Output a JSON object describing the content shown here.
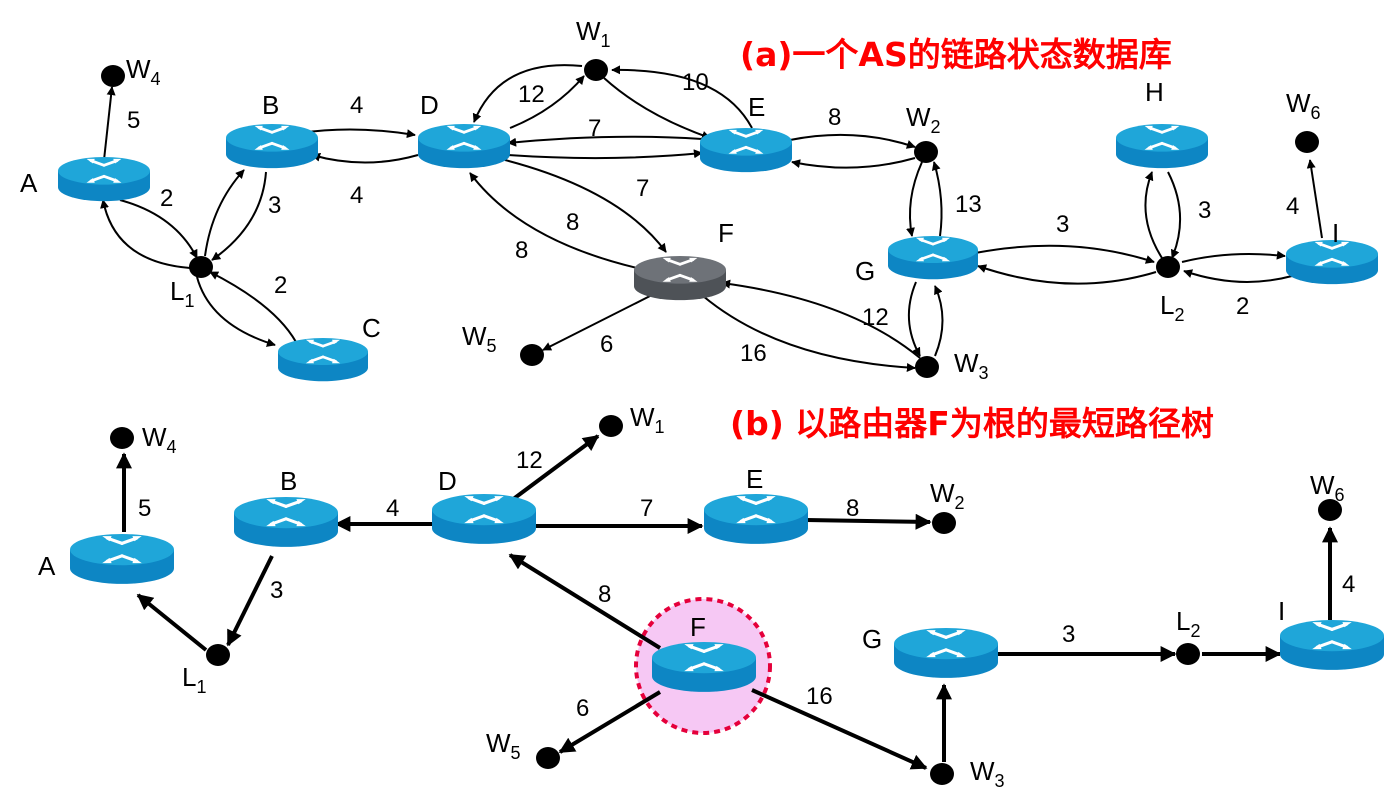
{
  "colors": {
    "title": "#ff0000",
    "router_top": "#1fa6d9",
    "router_body": "#0d86c4",
    "router_special_top": "#6e7278",
    "router_special_body": "#4e5257",
    "node": "#000000",
    "root_ring": "#e5003b",
    "root_fill": "#f6c8f4"
  },
  "icons": {
    "router": "router-icon",
    "network": "network-dot-icon"
  },
  "panel_a": {
    "title": "(a)一个AS的链路状态数据库",
    "routers": {
      "A": "A",
      "B": "B",
      "C": "C",
      "D": "D",
      "E": "E",
      "F": "F",
      "G": "G",
      "H": "H",
      "I": "I"
    },
    "networks": {
      "W1": {
        "base": "W",
        "sub": "1"
      },
      "W2": {
        "base": "W",
        "sub": "2"
      },
      "W3": {
        "base": "W",
        "sub": "3"
      },
      "W4": {
        "base": "W",
        "sub": "4"
      },
      "W5": {
        "base": "W",
        "sub": "5"
      },
      "W6": {
        "base": "W",
        "sub": "6"
      },
      "L1": {
        "base": "L",
        "sub": "1"
      },
      "L2": {
        "base": "L",
        "sub": "2"
      }
    },
    "links": [
      {
        "from": "A",
        "to": "W4",
        "cost": "5"
      },
      {
        "from": "A",
        "to": "L1",
        "cost": "2"
      },
      {
        "from": "L1",
        "to": "A",
        "cost": ""
      },
      {
        "from": "L1",
        "to": "B",
        "cost": ""
      },
      {
        "from": "B",
        "to": "L1",
        "cost": "3"
      },
      {
        "from": "L1",
        "to": "C",
        "cost": ""
      },
      {
        "from": "C",
        "to": "L1",
        "cost": "2"
      },
      {
        "from": "B",
        "to": "D",
        "cost": "4"
      },
      {
        "from": "D",
        "to": "B",
        "cost": "4"
      },
      {
        "from": "D",
        "to": "W1",
        "cost": "12"
      },
      {
        "from": "W1",
        "to": "D",
        "cost": ""
      },
      {
        "from": "E",
        "to": "W1",
        "cost": "10"
      },
      {
        "from": "W1",
        "to": "E",
        "cost": ""
      },
      {
        "from": "E",
        "to": "D",
        "cost": "7"
      },
      {
        "from": "D",
        "to": "E",
        "cost": "7"
      },
      {
        "from": "D",
        "to": "F",
        "cost": "8"
      },
      {
        "from": "F",
        "to": "D",
        "cost": "8"
      },
      {
        "from": "E",
        "to": "W2",
        "cost": "8"
      },
      {
        "from": "W2",
        "to": "E",
        "cost": ""
      },
      {
        "from": "W2",
        "to": "G",
        "cost": ""
      },
      {
        "from": "G",
        "to": "W2",
        "cost": "13"
      },
      {
        "from": "F",
        "to": "W5",
        "cost": "6"
      },
      {
        "from": "F",
        "to": "W3",
        "cost": "16"
      },
      {
        "from": "W3",
        "to": "F",
        "cost": "12"
      },
      {
        "from": "G",
        "to": "W3",
        "cost": ""
      },
      {
        "from": "W3",
        "to": "G",
        "cost": ""
      },
      {
        "from": "G",
        "to": "L2",
        "cost": "3"
      },
      {
        "from": "L2",
        "to": "G",
        "cost": ""
      },
      {
        "from": "H",
        "to": "L2",
        "cost": "3"
      },
      {
        "from": "L2",
        "to": "H",
        "cost": ""
      },
      {
        "from": "L2",
        "to": "I",
        "cost": ""
      },
      {
        "from": "I",
        "to": "L2",
        "cost": "2"
      },
      {
        "from": "I",
        "to": "W6",
        "cost": "4"
      }
    ]
  },
  "panel_b": {
    "title": "(b)  以路由器F为根的最短路径树",
    "root": "F",
    "routers": {
      "A": "A",
      "B": "B",
      "D": "D",
      "E": "E",
      "F": "F",
      "G": "G",
      "I": "I"
    },
    "networks": {
      "W1": {
        "base": "W",
        "sub": "1"
      },
      "W2": {
        "base": "W",
        "sub": "2"
      },
      "W3": {
        "base": "W",
        "sub": "3"
      },
      "W4": {
        "base": "W",
        "sub": "4"
      },
      "W5": {
        "base": "W",
        "sub": "5"
      },
      "W6": {
        "base": "W",
        "sub": "6"
      },
      "L1": {
        "base": "L",
        "sub": "1"
      },
      "L2": {
        "base": "L",
        "sub": "2"
      }
    },
    "tree_edges": [
      {
        "from": "F",
        "to": "D",
        "cost": "8"
      },
      {
        "from": "F",
        "to": "W5",
        "cost": "6"
      },
      {
        "from": "F",
        "to": "W3",
        "cost": "16"
      },
      {
        "from": "D",
        "to": "B",
        "cost": "4"
      },
      {
        "from": "D",
        "to": "W1",
        "cost": "12"
      },
      {
        "from": "D",
        "to": "E",
        "cost": "7"
      },
      {
        "from": "E",
        "to": "W2",
        "cost": "8"
      },
      {
        "from": "B",
        "to": "L1",
        "cost": "3"
      },
      {
        "from": "L1",
        "to": "A",
        "cost": ""
      },
      {
        "from": "A",
        "to": "W4",
        "cost": "5"
      },
      {
        "from": "W3",
        "to": "G",
        "cost": ""
      },
      {
        "from": "G",
        "to": "L2",
        "cost": "3"
      },
      {
        "from": "L2",
        "to": "I",
        "cost": ""
      },
      {
        "from": "I",
        "to": "W6",
        "cost": "4"
      }
    ]
  }
}
